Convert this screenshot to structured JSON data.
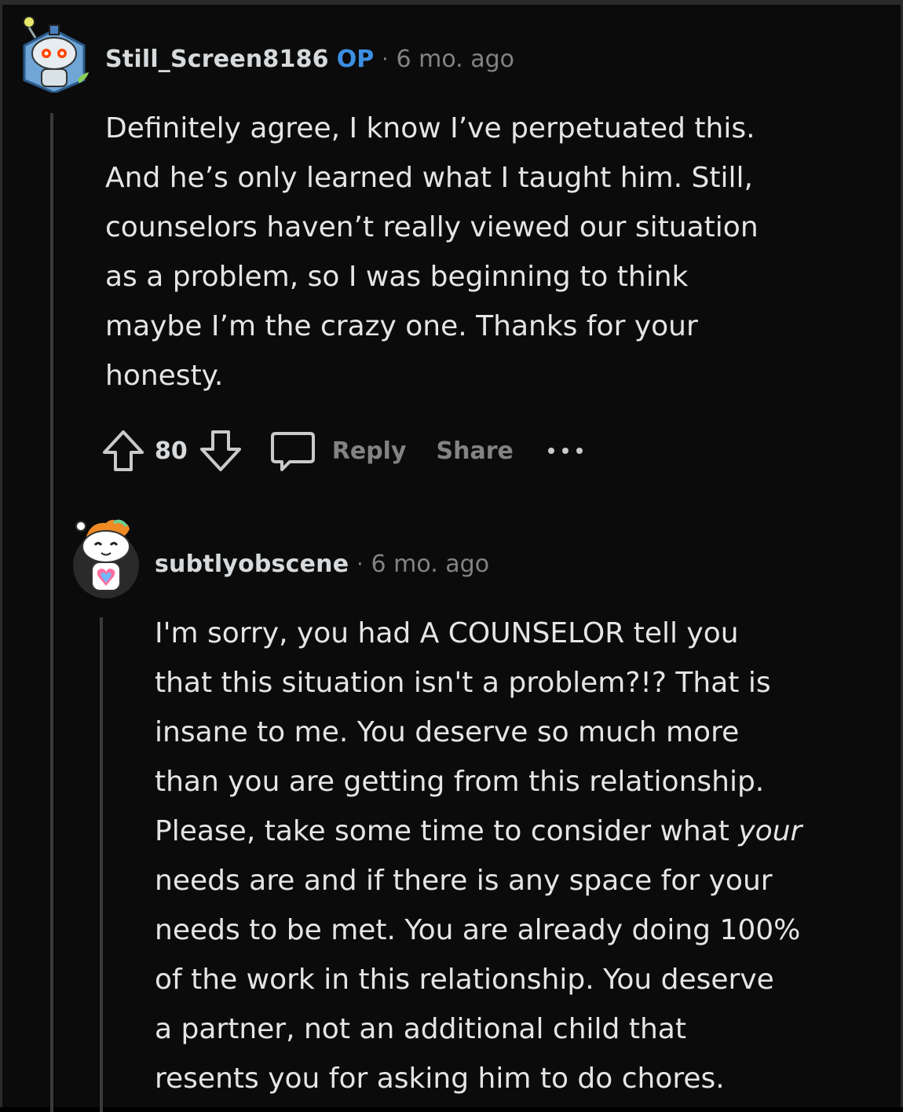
{
  "comments": [
    {
      "username": "Still_Screen8186",
      "op_badge": "OP",
      "separator": "·",
      "timestamp": "6 mo. ago",
      "avatar_icon": "snoo-robot-avatar",
      "body_lines": [
        "Definitely agree, I know I’ve perpetuated this.",
        "And he’s only learned what I taught him. Still,",
        "counselors haven’t really viewed our situation",
        "as a problem, so I was beginning to think",
        "maybe I’m the crazy one. Thanks for your",
        "honesty."
      ],
      "actions": {
        "upvote_icon": "upvote-arrow-icon",
        "vote_count": "80",
        "downvote_icon": "downvote-arrow-icon",
        "comment_icon": "speech-bubble-icon",
        "reply_label": "Reply",
        "share_label": "Share",
        "more_icon": "more-dots-icon"
      }
    },
    {
      "username": "subtlyobscene",
      "separator": "·",
      "timestamp": "6 mo. ago",
      "avatar_icon": "snoo-rainbow-heart-avatar",
      "body": {
        "line1": "I'm sorry, you had A COUNSELOR tell you",
        "line2": "that this situation isn't a problem?!? That is",
        "line3": "insane to me. You deserve so much more",
        "line4": "than you are getting from this relationship.",
        "line5_before": "Please, take some time to consider what ",
        "line5_emph": "your",
        "line6": "needs are and if there is any space for your",
        "line7": "needs to be met. You are already doing 100%",
        "line8": "of the work in this relationship. You deserve",
        "line9": "a partner, not an additional child that",
        "line10": "resents you for asking him to do chores."
      }
    }
  ],
  "colors": {
    "background": "#0b0b0b",
    "text_primary": "#e3e5e6",
    "text_muted": "#818384",
    "op_blue": "#3c8fe3",
    "thread_line": "#3a3a3a"
  }
}
